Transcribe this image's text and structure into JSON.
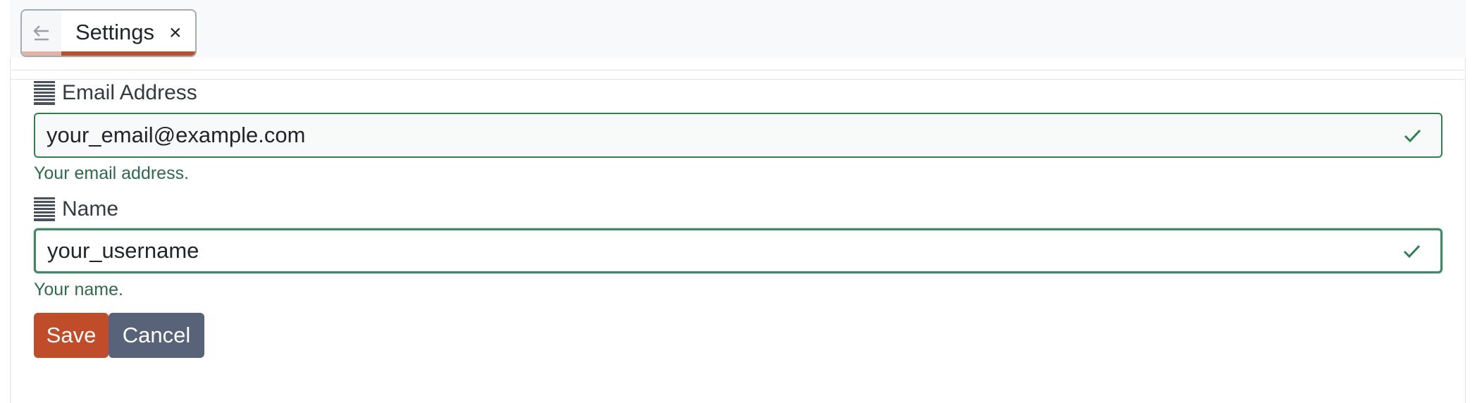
{
  "tab": {
    "label": "Settings",
    "back_icon": "arrow-left-icon",
    "close_glyph": "×"
  },
  "fields": [
    {
      "label": "Email Address",
      "value": "your_email@example.com",
      "help": "Your email address.",
      "icon": "lines-icon",
      "status_icon": "check-icon"
    },
    {
      "label": "Name",
      "value": "your_username",
      "help": "Your name.",
      "icon": "lines-icon",
      "status_icon": "check-icon"
    }
  ],
  "buttons": {
    "save_label": "Save",
    "cancel_label": "Cancel"
  },
  "colors": {
    "accent": "#c14c2a",
    "valid": "#2e8152",
    "cancel": "#58637a"
  }
}
